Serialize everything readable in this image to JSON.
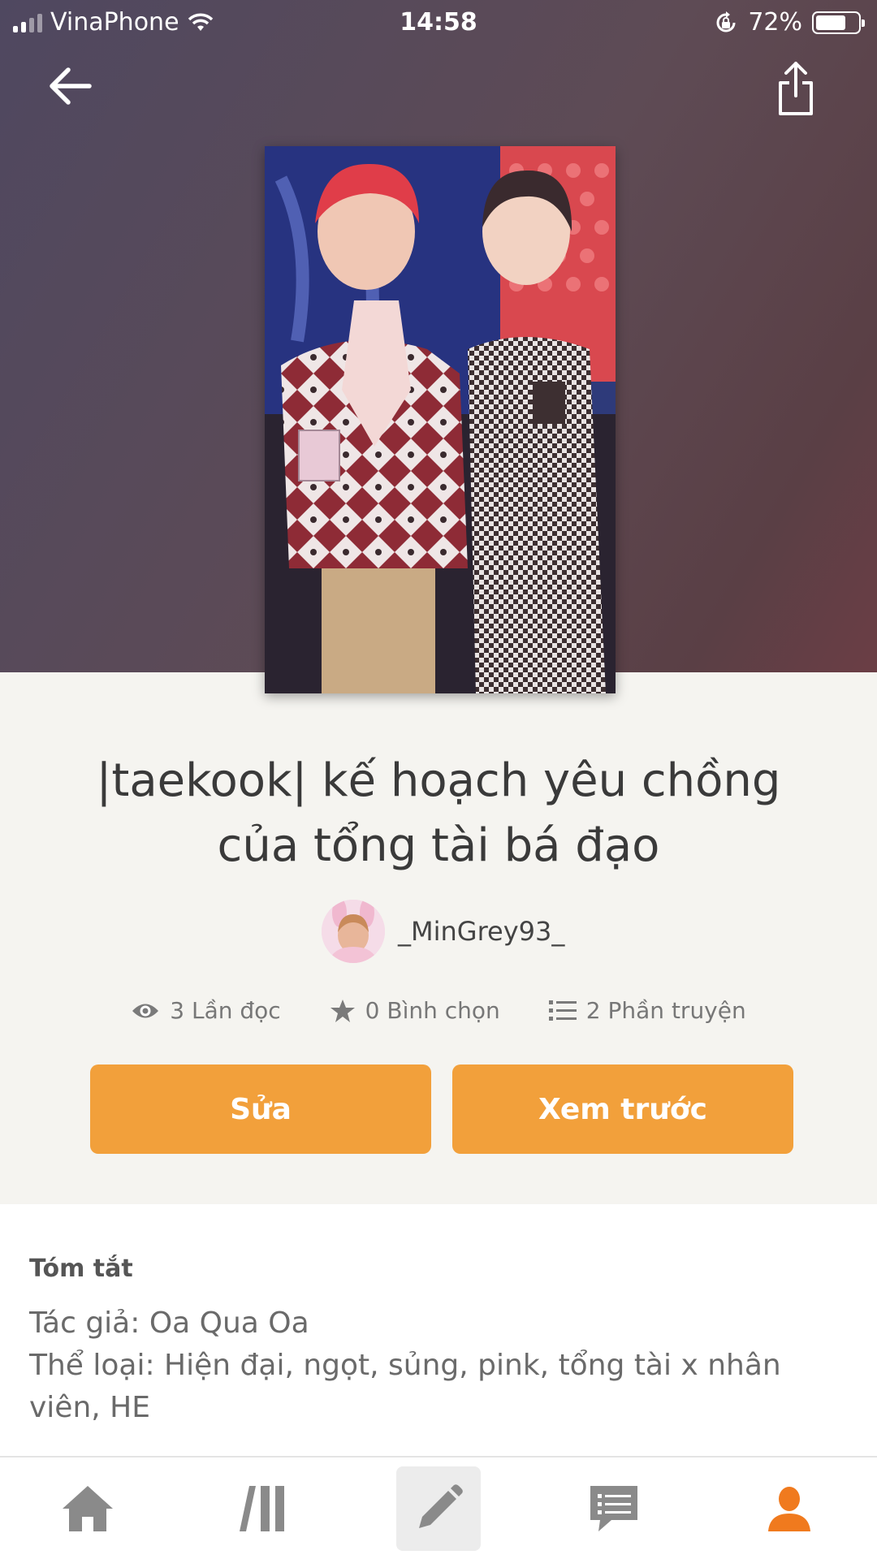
{
  "status_bar": {
    "carrier": "VinaPhone",
    "time": "14:58",
    "battery": "72%",
    "battery_level": 0.72
  },
  "header": {
    "back_icon": "arrow-left-icon",
    "share_icon": "share-icon"
  },
  "story": {
    "title": "|taekook| kế hoạch yêu chồng của tổng tài bá đạo",
    "author": "_MinGrey93_",
    "stats": {
      "reads": "3 Lần đọc",
      "votes": "0 Bình chọn",
      "parts": "2 Phần truyện"
    }
  },
  "actions": {
    "edit_label": "Sửa",
    "preview_label": "Xem trước"
  },
  "summary": {
    "heading": "Tóm tắt",
    "lines": [
      "Tác giả: Oa Qua Oa",
      "Thể loại: Hiện đại, ngọt, sủng, pink, tổng tài x nhân viên, HE"
    ]
  },
  "bottom_nav": {
    "items": [
      "home-icon",
      "library-icon",
      "write-icon",
      "messages-icon",
      "profile-icon"
    ],
    "active": "profile-icon"
  },
  "colors": {
    "accent": "#f2a03b",
    "active_nav": "#f07a1e",
    "inactive_nav": "#8a8a8a"
  }
}
